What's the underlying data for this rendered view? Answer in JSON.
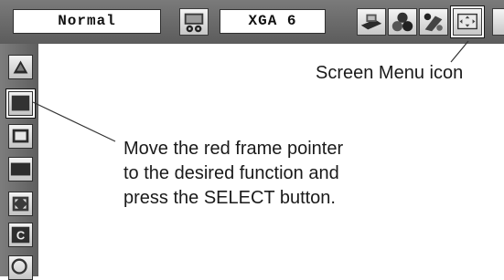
{
  "top_menu": {
    "mode_label": "Normal",
    "source_label": "XGA 6",
    "icons": [
      "pc-adjust-icon",
      "image-select-icon",
      "image-adjust-icon",
      "setting-icon",
      "screen-menu-icon"
    ]
  },
  "side_menu": {
    "icons": [
      "up-arrow-icon",
      "normal-screen-icon",
      "true-screen-icon",
      "wide-screen-icon",
      "custom-screen-icon",
      "keystone-c-icon",
      "digital-zoom-icon"
    ]
  },
  "annotations": {
    "screen_menu_icon": "Screen Menu icon",
    "instruction_line1": "Move the red frame pointer",
    "instruction_line2": "to the desired function and",
    "instruction_line3": "press the SELECT button."
  },
  "colors": {
    "menu_bar": "#6b6b6b",
    "pointer_frame": "#111111"
  }
}
